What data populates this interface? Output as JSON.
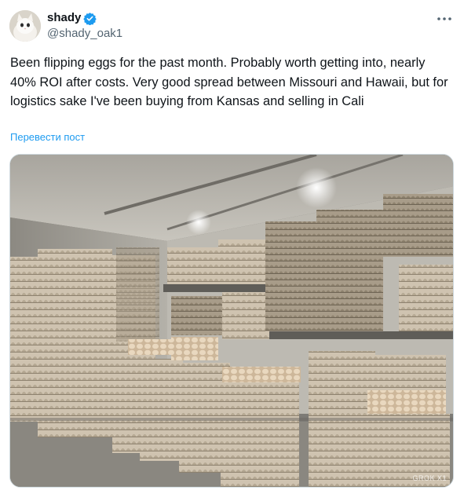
{
  "author": {
    "display_name": "shady",
    "handle": "@shady_oak1",
    "avatar_icon": "cat-avatar",
    "verified": true
  },
  "tweet": {
    "text": "Been flipping eggs for the past month. Probably worth getting into, nearly 40% ROI after costs. Very good spread between Missouri and Hawaii, but for logistics sake I've been buying from Kansas and selling in Cali",
    "translate_label": "Перевести пост"
  },
  "media": {
    "description_icon": "egg-warehouse-photo",
    "watermark": "GROK X1"
  },
  "colors": {
    "accent": "#1d9bf0",
    "text": "#0f1419",
    "secondary": "#536471"
  }
}
